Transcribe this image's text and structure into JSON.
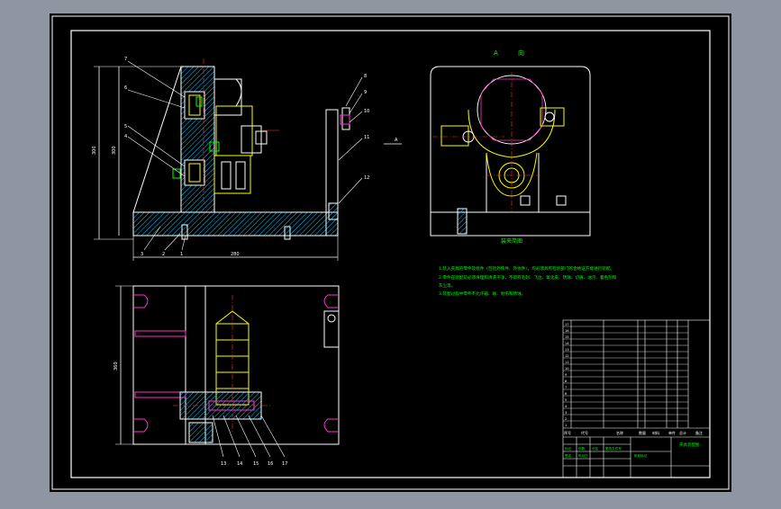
{
  "background_colors": {
    "workspace": "#8e96a2",
    "canvas": "#000000",
    "frame": "#ffffff",
    "hatch": "#00c8ff",
    "note": "#00ff00",
    "part": "#ffff00",
    "dim": "#ff3333",
    "line": "#ff00ff"
  },
  "view_a": {
    "title_a": "A",
    "title_dir": "向",
    "caption": "装夹简图"
  },
  "dimensions": {
    "height_label": "300",
    "width_label": "280",
    "bottom_height_label": "360",
    "section_mark": "A"
  },
  "balloons_top": [
    "7",
    "6",
    "5",
    "4",
    "3",
    "2",
    "1",
    "8",
    "9",
    "10",
    "11",
    "12"
  ],
  "balloons_bottom": [
    "13",
    "14",
    "15",
    "16",
    "17"
  ],
  "notes": [
    "1.装入夹具的零件及组件（包括外购件、外协件），均必须具有检验部门的合格证方能进行装配。",
    "2.零件在装配前必须清理和清洗干净，不得有毛刺、飞边、氧化皮、锈蚀、切屑、油污、着色剂和",
    "灰尘等。",
    "3.装配过程中零件不允许磕、碰、划伤和锈蚀。"
  ],
  "title_block": {
    "rows": [
      "17",
      "16",
      "15",
      "14",
      "13",
      "12",
      "11",
      "10",
      "9",
      "8",
      "7",
      "6",
      "5",
      "4",
      "3",
      "2",
      "1"
    ],
    "header": [
      "序号",
      "代号",
      "名称",
      "数量",
      "材料",
      "单件",
      "总计",
      "备注"
    ],
    "bottom_labels": [
      "标记",
      "处数",
      "分区",
      "更改文件号",
      "签名",
      "年月日"
    ],
    "stage": "阶段标记",
    "drawing_name": "夹具装配图"
  }
}
